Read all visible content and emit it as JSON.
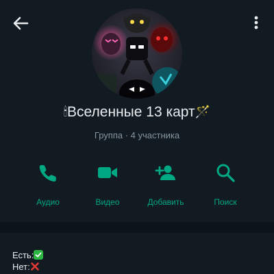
{
  "header": {
    "back_icon": "arrow-left-icon",
    "menu_icon": "more-vert-icon"
  },
  "group": {
    "title_prefix_emoji": "🕯",
    "title": "Вселенные 13 карт",
    "title_suffix_emoji": "🪄",
    "subtitle": "Группа · 4 участника"
  },
  "actions": [
    {
      "label": "Аудио",
      "icon": "phone-icon"
    },
    {
      "label": "Видео",
      "icon": "video-camera-icon"
    },
    {
      "label": "Добавить",
      "icon": "add-person-icon"
    },
    {
      "label": "Поиск",
      "icon": "search-icon"
    }
  ],
  "description": {
    "yes_label": "Есть:",
    "no_label": "Нет:"
  },
  "colors": {
    "background": "#121b22",
    "accent": "#00a884",
    "muted_text": "#8696a0",
    "divider": "#0b141a"
  }
}
